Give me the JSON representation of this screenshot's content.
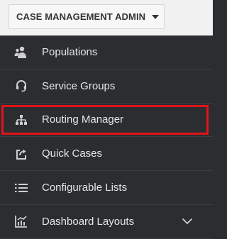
{
  "header": {
    "admin_menu_label": "CASE MANAGEMENT ADMIN"
  },
  "menu": {
    "items": [
      {
        "label": "Populations",
        "icon": "users-icon"
      },
      {
        "label": "Service Groups",
        "icon": "headset-icon"
      },
      {
        "label": "Routing Manager",
        "icon": "sitemap-icon",
        "selected": true
      },
      {
        "label": "Quick Cases",
        "icon": "share-box-icon"
      },
      {
        "label": "Configurable Lists",
        "icon": "list-icon"
      },
      {
        "label": "Dashboard Layouts",
        "icon": "chart-icon",
        "expandable": true
      }
    ]
  },
  "colors": {
    "sidebar_bg": "#2b2d31",
    "text": "#e6e6e6",
    "icon": "#cfcfcf",
    "highlight_border": "#e0141a",
    "topbar_bg": "#f1f1f1"
  }
}
